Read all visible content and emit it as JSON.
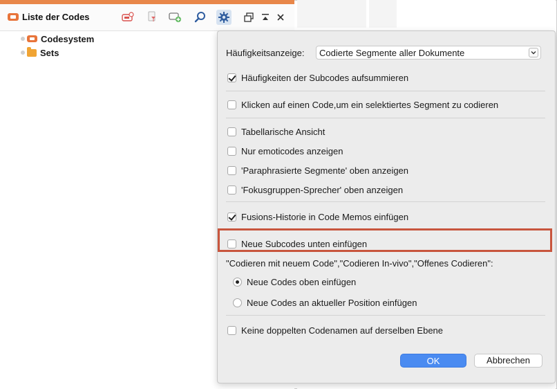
{
  "panel": {
    "title": "Liste der Codes",
    "tree": [
      {
        "label": "Codesystem"
      },
      {
        "label": "Sets"
      }
    ]
  },
  "toolbar": {
    "icons": [
      "new-code-icon",
      "filter-icon",
      "add-code-icon",
      "search-icon",
      "gear-icon",
      "undock-icon",
      "collapse-icon",
      "close-icon"
    ]
  },
  "popup": {
    "frequency_label": "Häufigkeitsanzeige:",
    "frequency_value": "Codierte Segmente aller Dokumente",
    "options": [
      {
        "label": "Häufigkeiten der Subcodes aufsummieren",
        "checked": true
      },
      {
        "label": "Klicken auf einen Code,um ein selektiertes Segment zu codieren",
        "checked": false
      },
      {
        "label": "Tabellarische Ansicht",
        "checked": false
      },
      {
        "label": "Nur emoticodes anzeigen",
        "checked": false
      },
      {
        "label": "'Paraphrasierte Segmente' oben anzeigen",
        "checked": false
      },
      {
        "label": "'Fokusgruppen-Sprecher' oben anzeigen",
        "checked": false
      },
      {
        "label": "Fusions-Historie in Code Memos einfügen",
        "checked": true
      },
      {
        "label": "Neue Subcodes unten einfügen",
        "checked": false
      }
    ],
    "new_code_heading": "\"Codieren mit neuem Code\",\"Codieren In-vivo\",\"Offenes Codieren\":",
    "radios": [
      {
        "label": "Neue Codes oben einfügen",
        "checked": true
      },
      {
        "label": "Neue Codes an aktueller Position einfügen",
        "checked": false
      }
    ],
    "no_duplicates_label": "Keine doppelten Codenamen auf derselben Ebene",
    "ok_label": "OK",
    "cancel_label": "Abbrechen"
  },
  "colors": {
    "accent": "#e8874a",
    "highlight": "#c8553d",
    "primary_button": "#4a8bf1"
  }
}
